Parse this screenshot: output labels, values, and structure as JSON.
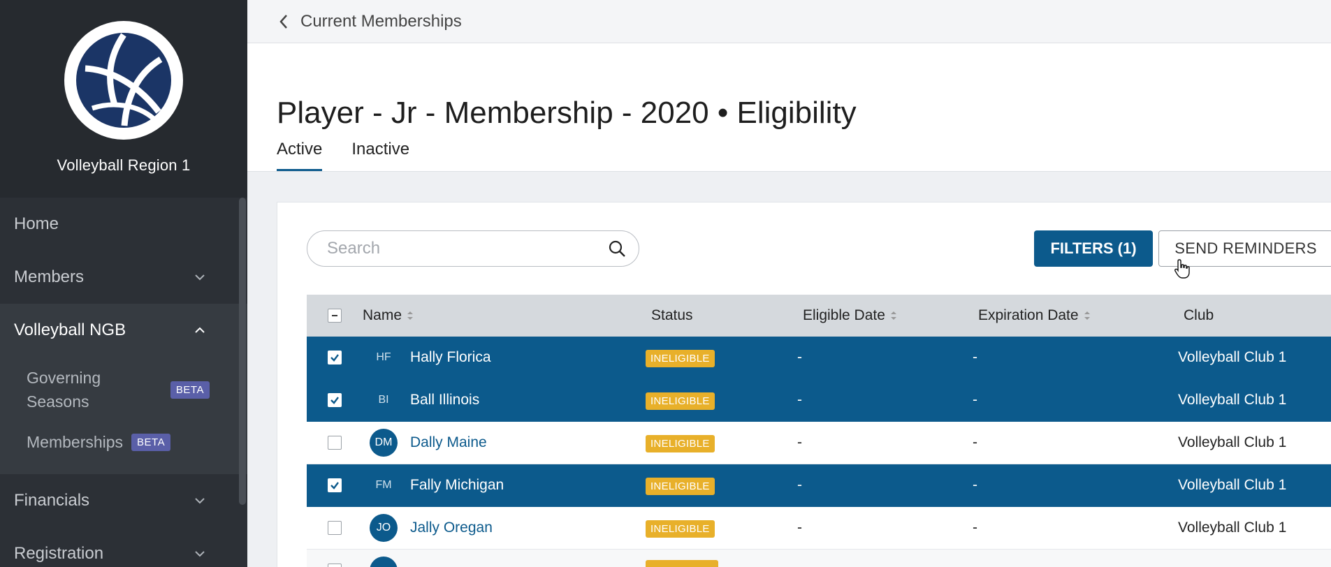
{
  "sidebar": {
    "org_name": "Volleyball Region 1",
    "items": [
      {
        "label": "Home"
      },
      {
        "label": "Members"
      },
      {
        "label": "Volleyball NGB"
      },
      {
        "label": "Financials"
      },
      {
        "label": "Registration"
      }
    ],
    "sub_items": [
      {
        "label_line1": "Governing",
        "label_line2": "Seasons",
        "badge": "BETA"
      },
      {
        "label": "Memberships",
        "badge": "BETA"
      }
    ]
  },
  "breadcrumb": {
    "back_label": "Current Memberships"
  },
  "page": {
    "title": "Player - Jr - Membership - 2020 • Eligibility"
  },
  "tabs": [
    {
      "label": "Active",
      "active": true
    },
    {
      "label": "Inactive",
      "active": false
    }
  ],
  "toolbar": {
    "search_placeholder": "Search",
    "filters_label": "FILTERS (1)",
    "send_reminders_label": "SEND REMINDERS"
  },
  "table": {
    "columns": [
      "Name",
      "Status",
      "Eligible Date",
      "Expiration Date",
      "Club"
    ],
    "rows": [
      {
        "initials": "HF",
        "name": "Hally Florica",
        "status": "INELIGIBLE",
        "eligible": "-",
        "expiration": "-",
        "club": "Volleyball Club 1",
        "selected": true
      },
      {
        "initials": "BI",
        "name": "Ball Illinois",
        "status": "INELIGIBLE",
        "eligible": "-",
        "expiration": "-",
        "club": "Volleyball Club 1",
        "selected": true
      },
      {
        "initials": "DM",
        "name": "Dally Maine",
        "status": "INELIGIBLE",
        "eligible": "-",
        "expiration": "-",
        "club": "Volleyball Club 1",
        "selected": false
      },
      {
        "initials": "FM",
        "name": "Fally Michigan",
        "status": "INELIGIBLE",
        "eligible": "-",
        "expiration": "-",
        "club": "Volleyball Club 1",
        "selected": true
      },
      {
        "initials": "JO",
        "name": "Jally Oregan",
        "status": "INELIGIBLE",
        "eligible": "-",
        "expiration": "-",
        "club": "Volleyball Club 1",
        "selected": false
      }
    ]
  },
  "colors": {
    "primary": "#0c5a8c",
    "sidebar_bg": "#2c3036",
    "badge_yellow": "#e8b02a",
    "beta_purple": "#5a5fa8"
  }
}
